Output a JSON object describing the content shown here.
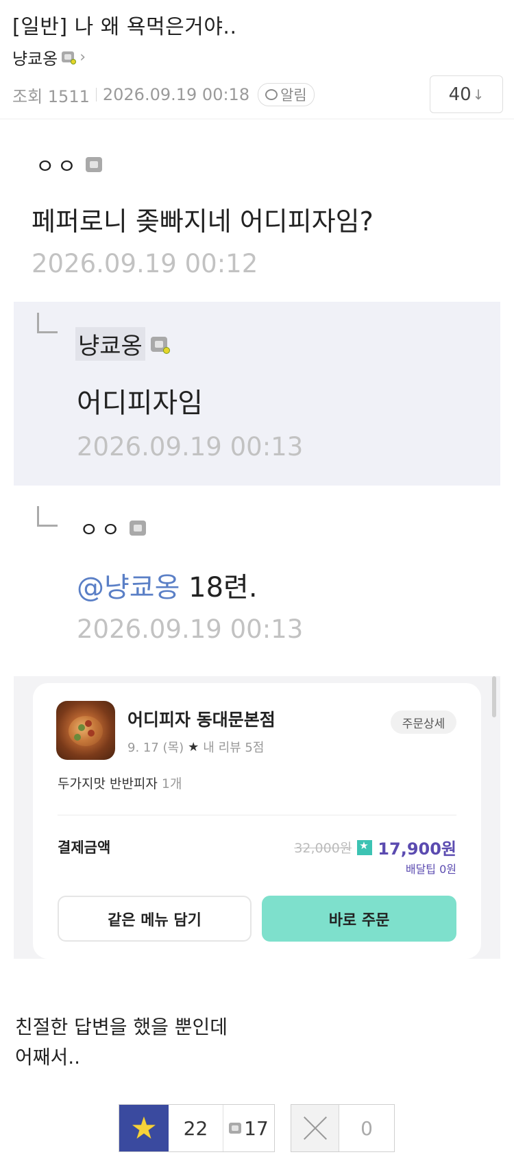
{
  "post": {
    "title": "[일반] 나 왜 욕먹은거야..",
    "author": "냥쿄옹",
    "views_label": "조회 1511",
    "datetime": "2026.09.19 00:18",
    "alarm_label": "알림",
    "comment_count": "40",
    "count_arrow": "↓"
  },
  "comments": [
    {
      "author": "ㅇㅇ",
      "text": "페퍼로니 좆빠지네 어디피자임?",
      "datetime": "2026.09.19 00:12"
    },
    {
      "author": "냥쿄옹",
      "text": "어디피자임",
      "datetime": "2026.09.19 00:13"
    },
    {
      "author": "ㅇㅇ",
      "mention": "@냥쿄옹",
      "text": " 18련.",
      "datetime": "2026.09.19 00:13"
    }
  ],
  "order_card": {
    "store_name": "어디피자 동대문본점",
    "order_date": "9. 17 (목)",
    "star": "★",
    "review_label": "내 리뷰 5점",
    "detail_button": "주문상세",
    "menu_item": "두가지맛 반반피자",
    "menu_qty": "1개",
    "pay_label": "결제금액",
    "old_price": "32,000원",
    "new_price": "17,900원",
    "delivery_tip": "배달팁 0원",
    "same_menu_button": "같은 메뉴 담기",
    "order_now_button": "바로 주문",
    "accent_color": "#5b4bb0",
    "button_color": "#7ee0cc"
  },
  "body": {
    "line1": "친절한 답변을 했을 뿐인데",
    "line2": "어째서.."
  },
  "votes": {
    "up_count": "22",
    "fix_count": "17",
    "down_count": "0"
  },
  "colors": {
    "vote_star_bg": "#3a4a9f",
    "mention": "#5a7fc6",
    "reply_bg": "#f0f1f7"
  }
}
